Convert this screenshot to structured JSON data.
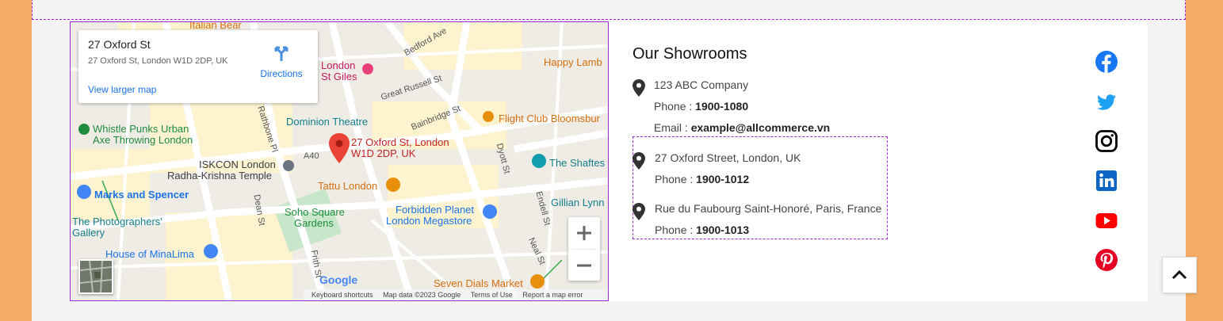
{
  "map": {
    "info": {
      "title": "27 Oxford St",
      "address": "27 Oxford St, London W1D 2DP, UK",
      "directions": "Directions",
      "larger_map": "View larger map"
    },
    "labels": {
      "italian_bear": "Italian Bear",
      "bedford_ave": "Bedford Ave",
      "london_st_giles_1": "London",
      "london_st_giles_2": "St Giles",
      "happy_lamb": "Happy Lamb",
      "whistle_1": "Whistle Punks Urban",
      "whistle_2": "Axe Throwing London",
      "great_russell": "Great Russell St",
      "dominion": "Dominion Theatre",
      "bainbridge": "Bainbridge St",
      "flight_club": "Flight Club Bloomsbur",
      "rathbone": "Rathbone Pl",
      "pin_label_1": "27 Oxford St, London",
      "pin_label_2": "W1D 2DP, UK",
      "a40": "A40",
      "iskcon_1": "ISKCON London",
      "iskcon_2": "Radha-Krishna Temple",
      "dyott": "Dyott St",
      "shaftes": "The Shaftes",
      "tattu": "Tattu London",
      "marks": "Marks and Spencer",
      "dean": "Dean St",
      "soho_1": "Soho Square",
      "soho_2": "Gardens",
      "forbidden_1": "Forbidden Planet",
      "forbidden_2": "London Megastore",
      "endell": "Endell St",
      "gillian": "Gillian Lynn",
      "photographers_1": "The Photographers'",
      "photographers_2": "Gallery",
      "mina": "House of MinaLima",
      "frith": "Frith St",
      "neal": "Neal St",
      "seven_dials": "Seven Dials Market"
    },
    "attribution": {
      "logo": "Google",
      "shortcuts": "Keyboard shortcuts",
      "map_data": "Map data ©2023 Google",
      "terms": "Terms of Use",
      "report": "Report a map error"
    }
  },
  "showrooms": {
    "title": "Our Showrooms",
    "phone_prefix": "Phone : ",
    "email_prefix": "Email : ",
    "items": [
      {
        "name": "123 ABC Company",
        "phone": "1900-1080",
        "email": "example@allcommerce.vn"
      },
      {
        "name": "27 Oxford Street, London, UK",
        "phone": "1900-1012"
      },
      {
        "name": "Rue du Faubourg Saint-Honoré, Paris, France",
        "phone": "1900-1013"
      }
    ]
  },
  "social": [
    "facebook-icon",
    "twitter-icon",
    "instagram-icon",
    "linkedin-icon",
    "youtube-icon",
    "pinterest-icon"
  ],
  "colors": {
    "side_background": "#f4ad66",
    "facebook": "#1877f2",
    "twitter": "#1da1f2",
    "linkedin": "#0a66c2",
    "youtube": "#ff0000",
    "pinterest": "#e60023",
    "selection": "#9b2bd0"
  }
}
